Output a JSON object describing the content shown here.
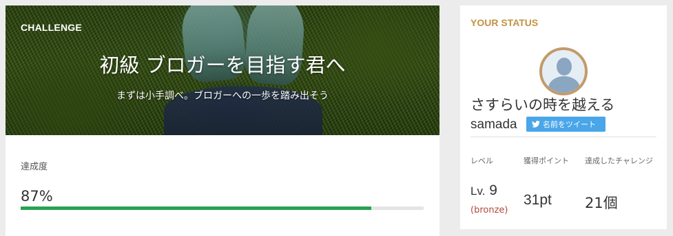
{
  "challenge": {
    "tag": "CHALLENGE",
    "title": "初級 ブロガーを目指す君へ",
    "subtitle": "まずは小手調べ。ブロガーへの一歩を踏み出そう",
    "progress_label": "達成度",
    "progress_text": "87%",
    "progress_value": 87,
    "progress_color": "#26a251"
  },
  "status": {
    "heading": "YOUR STATUS",
    "user_title": "さすらいの時を越える",
    "user_name": "samada",
    "tweet_label": "名前をツイート",
    "level_label": "レベル",
    "level_prefix": "Lv.",
    "level_value": "9",
    "level_rank": "(bronze)",
    "points_label": "獲得ポイント",
    "points_value": "31pt",
    "challenges_label": "達成したチャレンジ",
    "challenges_value": "21個",
    "accent_color": "#c19342"
  },
  "icons": {
    "avatar": "user-avatar-icon",
    "tweet": "twitter-bird-icon"
  }
}
